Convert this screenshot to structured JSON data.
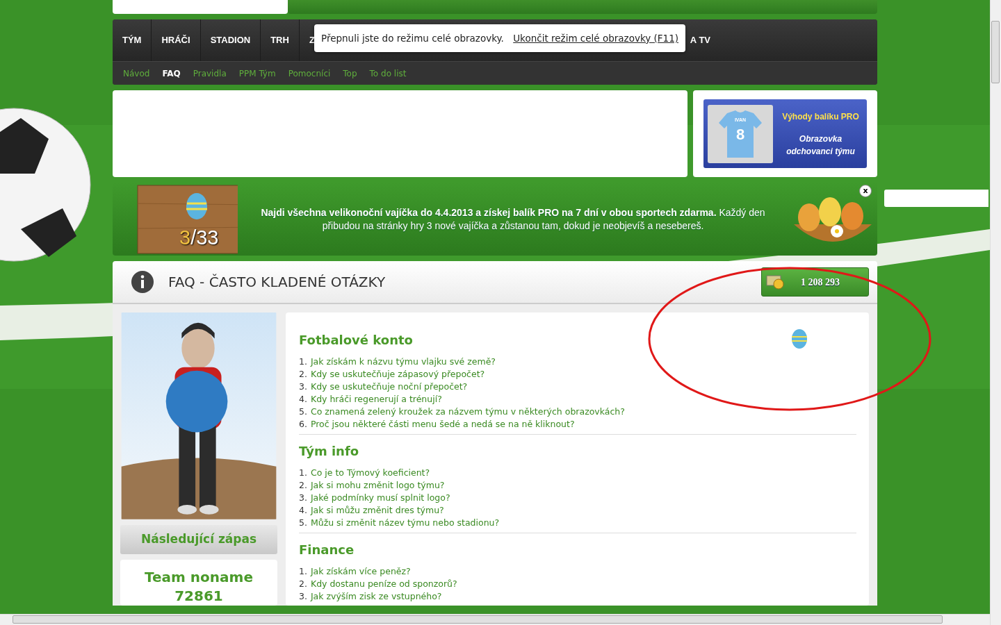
{
  "main_nav": {
    "items": [
      {
        "label": "TÝM",
        "selected": false
      },
      {
        "label": "HRÁČI",
        "selected": false
      },
      {
        "label": "STADION",
        "selected": false
      },
      {
        "label": "TRH",
        "selected": false
      },
      {
        "label": "Z",
        "selected": false
      },
      {
        "label": "A TV",
        "selected": false
      }
    ]
  },
  "fullscreen_notice": {
    "message": "Přepnuli jste do režimu celé obrazovky.",
    "link": "Ukončit režim celé obrazovky (F11)"
  },
  "sub_nav": {
    "items": [
      {
        "label": "Návod",
        "selected": false
      },
      {
        "label": "FAQ",
        "selected": true
      },
      {
        "label": "Pravidla",
        "selected": false
      },
      {
        "label": "PPM Tým",
        "selected": false
      },
      {
        "label": "Pomocníci",
        "selected": false
      },
      {
        "label": "Top",
        "selected": false
      },
      {
        "label": "To do list",
        "selected": false
      }
    ]
  },
  "promo": {
    "jersey_name": "IVAN",
    "jersey_number": "8",
    "title": "Výhody balíku PRO",
    "subtitle": "Obrazovka odchovanci týmu"
  },
  "easter_banner": {
    "found": "3",
    "total": "/33",
    "text": "**Najdi všechna velikonoční vajíčka do 4.4.2013 a získej balík PRO na 7 dní v obou sportech zdarma.** Každý den přibudou na stránky hry 3 nové vajíčka a zůstanou tam, dokud je neobjevíš a nesebereš.",
    "close": "x"
  },
  "page_header": {
    "title": "FAQ - ČASTO KLADENÉ OTÁZKY",
    "coins": "1 208 293"
  },
  "sidebar": {
    "next_match_label": "Následující zápas",
    "team_name": "Team noname 72861"
  },
  "faq_sections": [
    {
      "title": "Fotbalové konto",
      "questions": [
        {
          "number": "1.",
          "text": "Jak získám k názvu týmu vlajku své země?"
        },
        {
          "number": "2.",
          "text": "Kdy se uskutečňuje zápasový přepočet?"
        },
        {
          "number": "3.",
          "text": "Kdy se uskutečňuje noční přepočet?"
        },
        {
          "number": "4.",
          "text": "Kdy hráči regenerují a trénují?"
        },
        {
          "number": "5.",
          "text": "Co znamená zelený kroužek za názvem týmu v některých obrazovkách?"
        },
        {
          "number": "6.",
          "text": "Proč jsou některé části menu šedé a nedá se na ně kliknout?"
        }
      ]
    },
    {
      "title": "Tým info",
      "questions": [
        {
          "number": "1.",
          "text": "Co je to Týmový koeficient?"
        },
        {
          "number": "2.",
          "text": "Jak si mohu změnit logo týmu?"
        },
        {
          "number": "3.",
          "text": "Jaké podmínky musí splnit logo?"
        },
        {
          "number": "4.",
          "text": "Jak si můžu změnit dres týmu?"
        },
        {
          "number": "5.",
          "text": "Můžu si změnit název týmu nebo stadionu?"
        }
      ]
    },
    {
      "title": "Finance",
      "questions": [
        {
          "number": "1.",
          "text": "Jak získám více peněz?"
        },
        {
          "number": "2.",
          "text": "Kdy dostanu peníze od sponzorů?"
        },
        {
          "number": "3.",
          "text": "Jak zvýším zisk ze vstupného?"
        }
      ]
    }
  ]
}
